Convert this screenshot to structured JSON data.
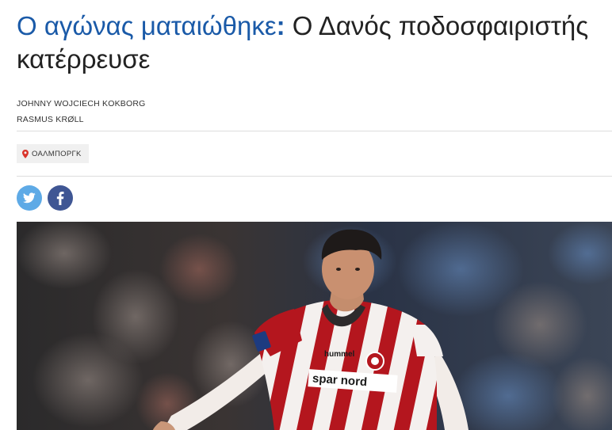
{
  "article": {
    "headline_kicker": "Ο αγώνας ματαιώθηκε",
    "headline_colon": ":",
    "headline_rest": " Ο Δανός ποδοσφαιριστής κατέρρευσε",
    "authors": [
      "JOHNNY WOJCIECH KOKBORG",
      "RASMUS KRØLL"
    ],
    "location": "ΟΑΛΜΠΟΡΓΚ",
    "share": {
      "twitter_icon": "twitter-icon",
      "facebook_icon": "facebook-icon"
    },
    "photo": {
      "jersey_sponsor": "spar nord",
      "jersey_brand": "hummel"
    }
  },
  "colors": {
    "kicker": "#1a5aa8",
    "headline": "#222222",
    "twitter": "#5eaae6",
    "facebook": "#3f5694",
    "jersey_red": "#b4161e"
  }
}
